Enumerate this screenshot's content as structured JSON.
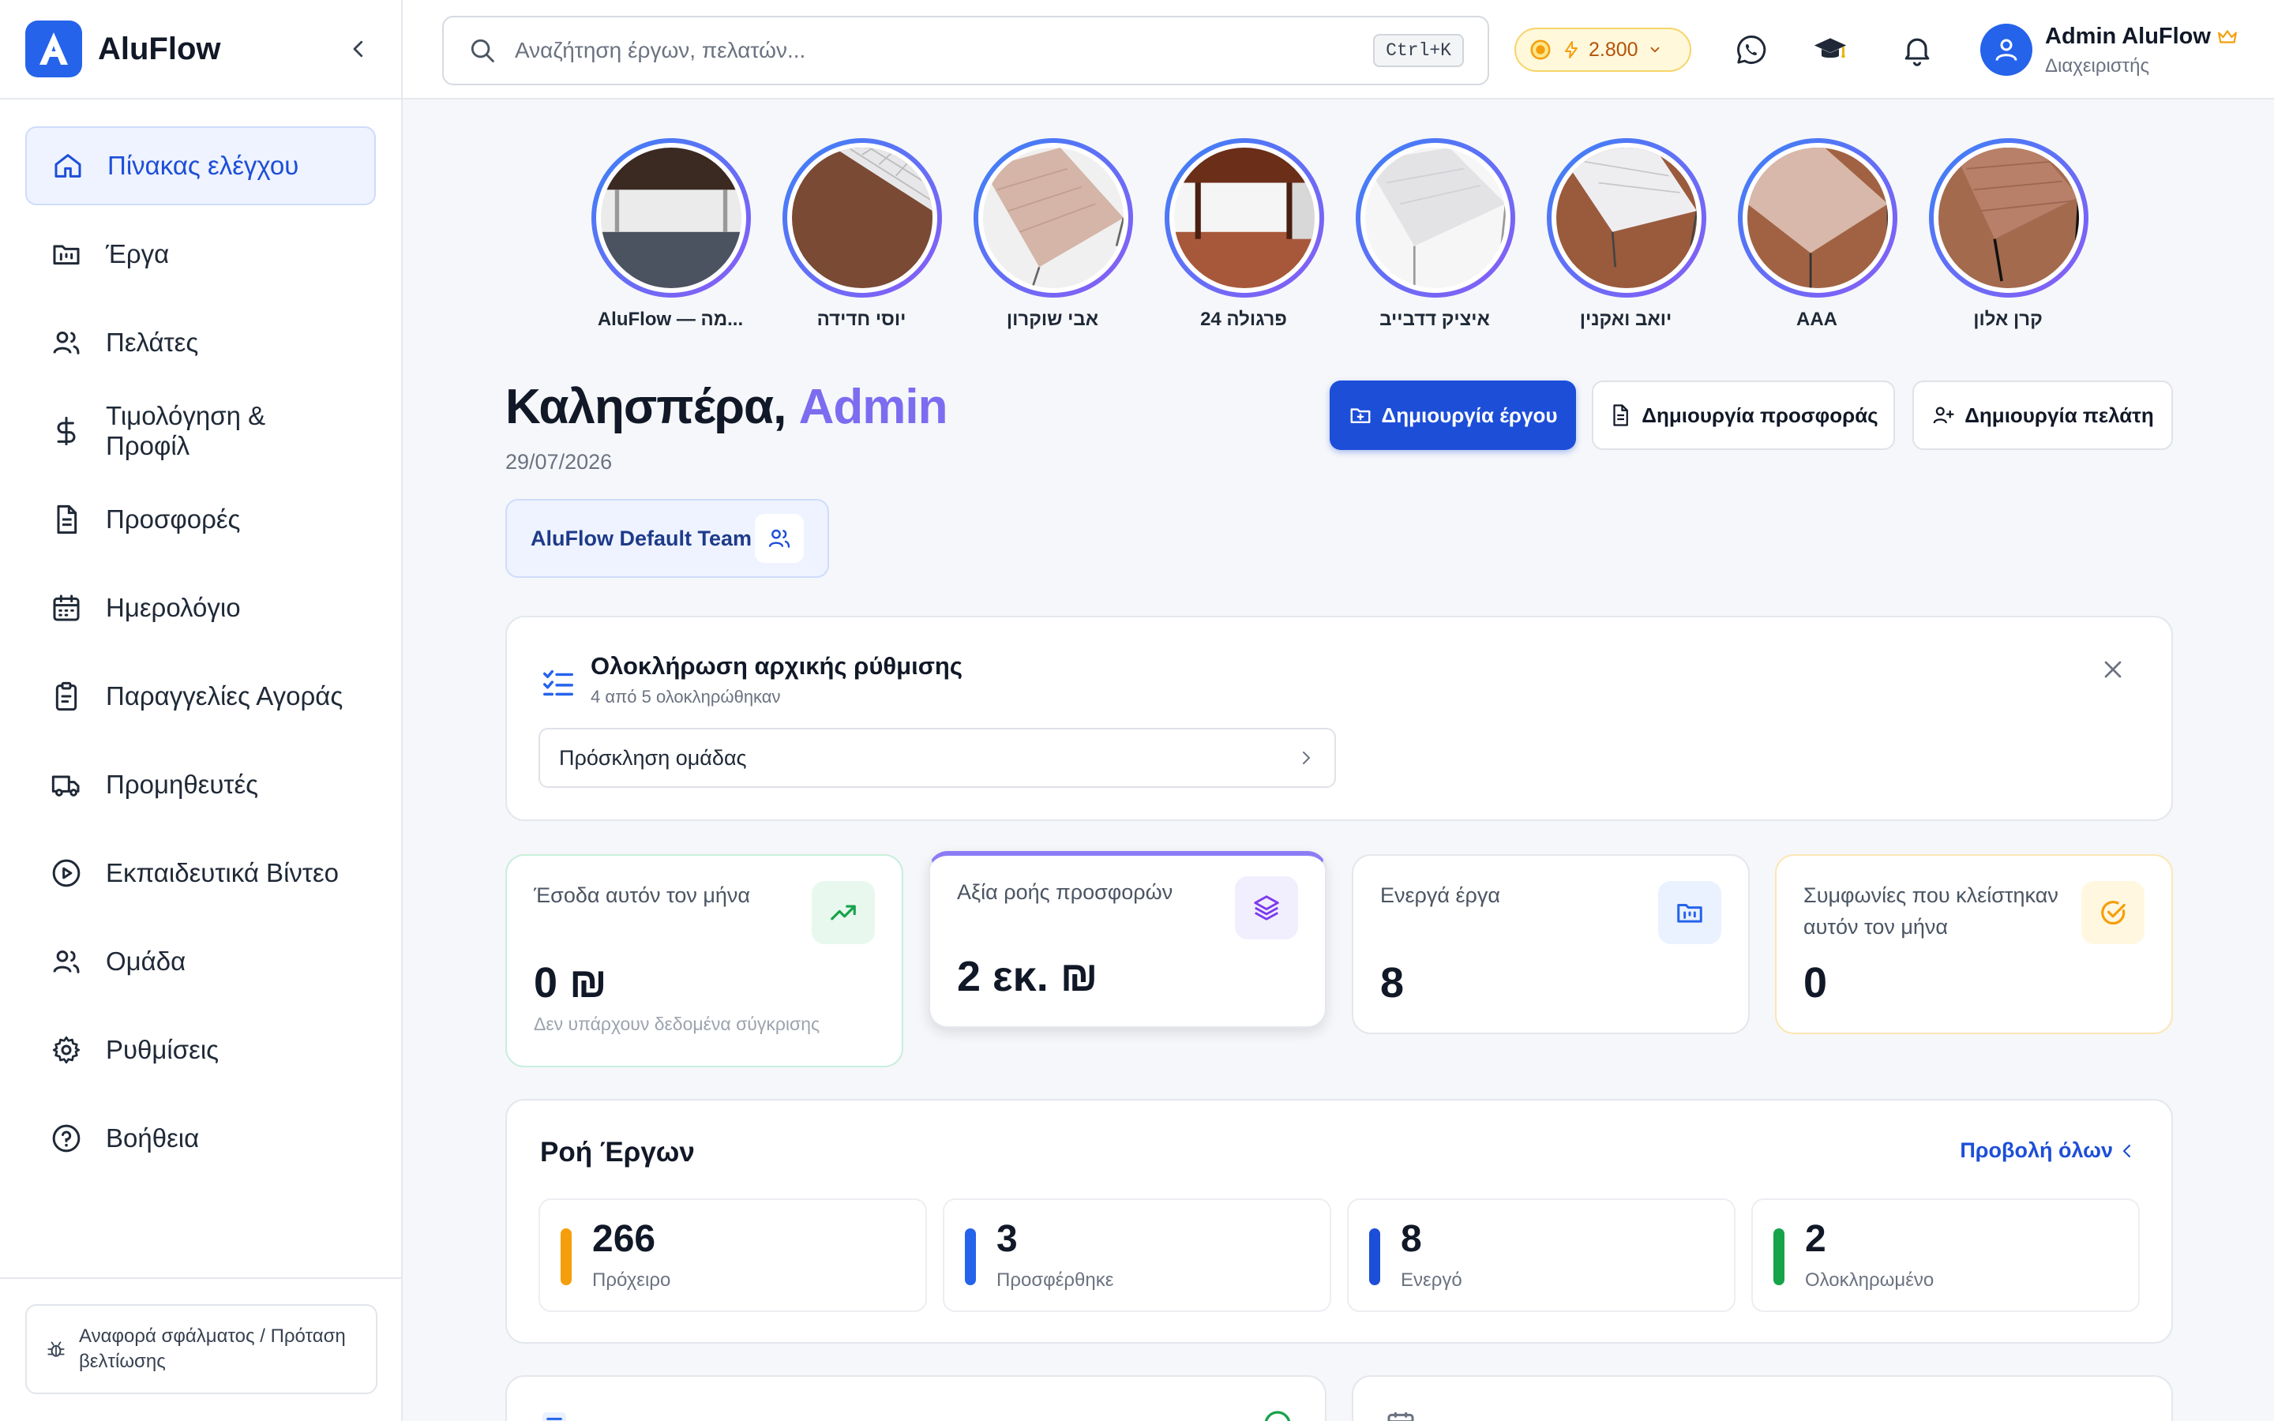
{
  "app": {
    "name": "AluFlow"
  },
  "colors": {
    "primary": "#1d4ed8",
    "accent": "#7c6cf0",
    "draft": "#f59e0b",
    "offered": "#2563eb",
    "active": "#1d4ed8",
    "done": "#16a34a"
  },
  "sidebar": {
    "items": [
      {
        "label": "Πίνακας ελέγχου",
        "icon": "home-icon"
      },
      {
        "label": "Έργα",
        "icon": "folder-kanban-icon"
      },
      {
        "label": "Πελάτες",
        "icon": "users-icon"
      },
      {
        "label": "Τιμολόγηση & Προφίλ",
        "icon": "dollar-icon"
      },
      {
        "label": "Προσφορές",
        "icon": "file-text-icon"
      },
      {
        "label": "Ημερολόγιο",
        "icon": "calendar-icon"
      },
      {
        "label": "Παραγγελίες Αγοράς",
        "icon": "clipboard-icon"
      },
      {
        "label": "Προμηθευτές",
        "icon": "truck-icon"
      },
      {
        "label": "Εκπαιδευτικά Βίντεο",
        "icon": "play-circle-icon"
      },
      {
        "label": "Ομάδα",
        "icon": "users-icon"
      },
      {
        "label": "Ρυθμίσεις",
        "icon": "gear-icon"
      },
      {
        "label": "Βοήθεια",
        "icon": "help-circle-icon"
      }
    ],
    "report_label": "Αναφορά σφάλματος / Πρόταση βελτίωσης"
  },
  "header": {
    "search_placeholder": "Αναζήτηση έργων, πελατών...",
    "shortcut": "Ctrl+K",
    "credits": "2.800",
    "user_name": "Admin AluFlow",
    "user_role": "Διαχειριστής"
  },
  "stories": [
    {
      "label": "AluFlow — מה..."
    },
    {
      "label": "יוסי חדידה"
    },
    {
      "label": "אבי שוקרון"
    },
    {
      "label": "פרגולה 24"
    },
    {
      "label": "איציק דדבייב"
    },
    {
      "label": "יואב ואקנין"
    },
    {
      "label": "AAA"
    },
    {
      "label": "קרן אלון"
    }
  ],
  "greeting": {
    "prefix": "Καλησπέρα, ",
    "name": "Admin",
    "date": "29/07/2026",
    "team": "AluFlow Default Team"
  },
  "actions": {
    "create_project": "Δημιουργία έργου",
    "create_offer": "Δημιουργία προσφοράς",
    "create_client": "Δημιουργία πελάτη"
  },
  "setup": {
    "title": "Ολοκλήρωση αρχικής ρύθμισης",
    "subtitle": "4 από 5 ολοκληρώθηκαν",
    "item": "Πρόσκληση ομάδας",
    "completed": 4,
    "total": 5
  },
  "kpis": [
    {
      "label": "Έσοδα αυτόν τον μήνα",
      "value": "0 ₪",
      "sub": "Δεν υπάρχουν δεδομένα σύγκρισης"
    },
    {
      "label": "Αξία ροής προσφορών",
      "value": "2 εκ. ₪"
    },
    {
      "label": "Ενεργά έργα",
      "value": "8"
    },
    {
      "label": "Συμφωνίες που κλείστηκαν αυτόν τον μήνα",
      "value": "0"
    }
  ],
  "flow": {
    "title": "Ροή Έργων",
    "view_all": "Προβολή όλων",
    "stats": [
      {
        "value": "266",
        "label": "Πρόχειρο"
      },
      {
        "value": "3",
        "label": "Προσφέρθηκε"
      },
      {
        "value": "8",
        "label": "Ενεργό"
      },
      {
        "value": "2",
        "label": "Ολοκληρωμένο"
      }
    ]
  }
}
